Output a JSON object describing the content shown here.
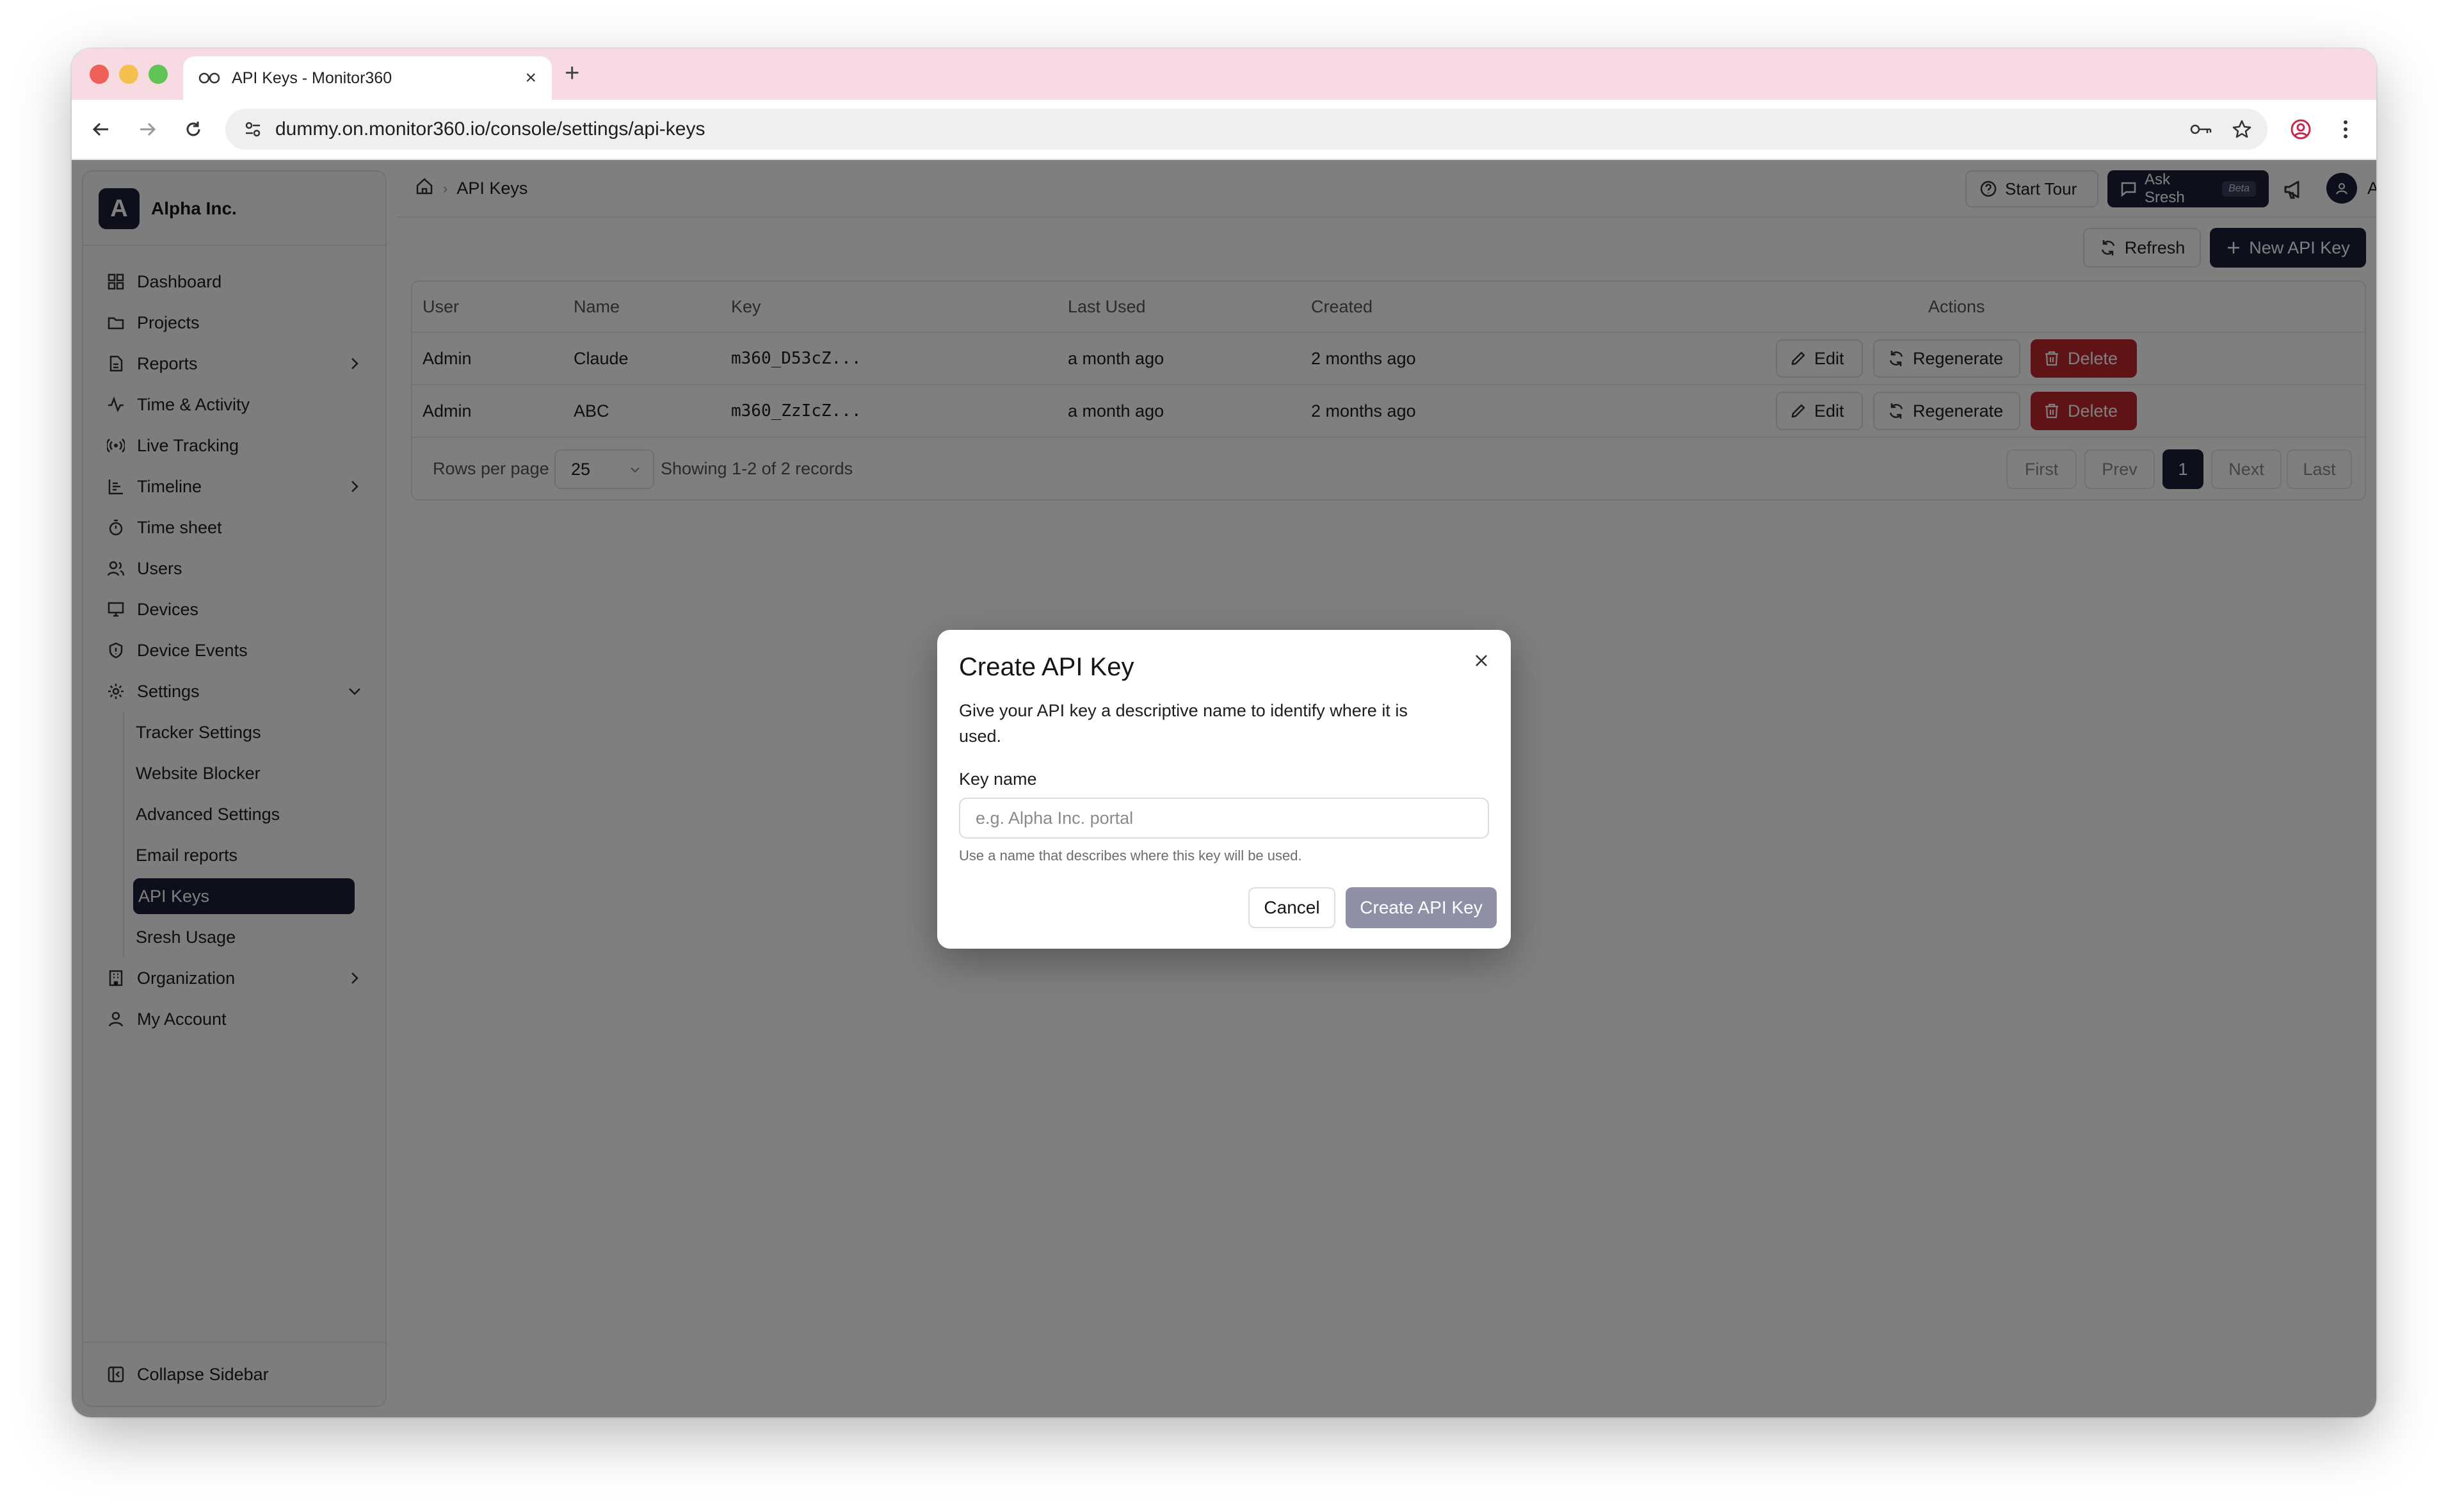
{
  "browser": {
    "tab_title": "API Keys - Monitor360",
    "url": "dummy.on.monitor360.io/console/settings/api-keys"
  },
  "sidebar": {
    "org_initial": "A",
    "org_name": "Alpha Inc.",
    "items": [
      {
        "label": "Dashboard",
        "icon": "dashboard-icon"
      },
      {
        "label": "Projects",
        "icon": "folder-icon"
      },
      {
        "label": "Reports",
        "icon": "file-icon"
      },
      {
        "label": "Time & Activity",
        "icon": "activity-icon"
      },
      {
        "label": "Live Tracking",
        "icon": "radio-icon"
      },
      {
        "label": "Timeline",
        "icon": "timeline-icon"
      },
      {
        "label": "Time sheet",
        "icon": "timer-icon"
      },
      {
        "label": "Users",
        "icon": "users-icon"
      },
      {
        "label": "Devices",
        "icon": "monitor-icon"
      },
      {
        "label": "Device Events",
        "icon": "shield-icon"
      },
      {
        "label": "Settings",
        "icon": "gear-icon"
      }
    ],
    "settings_sub": [
      "Tracker Settings",
      "Website Blocker",
      "Advanced Settings",
      "Email reports",
      "API Keys",
      "Sresh Usage"
    ],
    "after_items": [
      {
        "label": "Organization",
        "icon": "building-icon"
      },
      {
        "label": "My Account",
        "icon": "user-icon"
      }
    ],
    "collapse_label": "Collapse Sidebar"
  },
  "header": {
    "breadcrumb": "API Keys",
    "start_tour": "Start Tour",
    "ask_sresh": "Ask Sresh",
    "beta": "Beta",
    "admin": "Admin"
  },
  "actions": {
    "refresh": "Refresh",
    "new_key": "New API Key"
  },
  "table": {
    "columns": [
      "User",
      "Name",
      "Key",
      "Last Used",
      "Created",
      "Actions"
    ],
    "rows": [
      {
        "user": "Admin",
        "name": "Claude",
        "key": "m360_D53cZ...",
        "last_used": "a month ago",
        "created": "2 months ago"
      },
      {
        "user": "Admin",
        "name": "ABC",
        "key": "m360_ZzIcZ...",
        "last_used": "a month ago",
        "created": "2 months ago"
      }
    ],
    "row_actions": {
      "edit": "Edit",
      "regenerate": "Regenerate",
      "delete": "Delete"
    },
    "rows_per_page_label": "Rows per page",
    "rows_per_page": "25",
    "showing": "Showing 1-2 of 2 records",
    "pagination": {
      "first": "First",
      "prev": "Prev",
      "current": "1",
      "next": "Next",
      "last": "Last"
    }
  },
  "modal": {
    "title": "Create API Key",
    "description": "Give your API key a descriptive name to identify where it is used.",
    "field_label": "Key name",
    "placeholder": "e.g. Alpha Inc. portal",
    "value": "",
    "hint": "Use a name that describes where this key will be used.",
    "cancel": "Cancel",
    "create": "Create API Key"
  },
  "colors": {
    "primary": "#1c1f3a",
    "danger": "#c0262d",
    "titlebar": "#f8dbe2",
    "disabled_primary": "#8f8fa6"
  }
}
